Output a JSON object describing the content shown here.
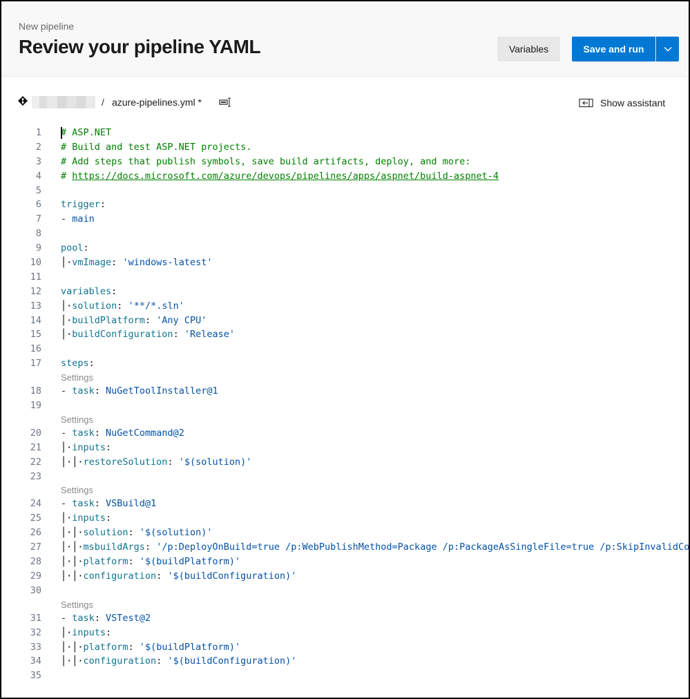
{
  "header": {
    "subtitle": "New pipeline",
    "title": "Review your pipeline YAML",
    "variables_button": "Variables",
    "save_run_button": "Save and run"
  },
  "filebar": {
    "separator": "/",
    "filename": "azure-pipelines.yml *",
    "show_assistant": "Show assistant"
  },
  "settings_label": "Settings",
  "lines": [
    {
      "n": "1",
      "segs": [
        [
          "comment",
          "# ASP.NET"
        ]
      ]
    },
    {
      "n": "2",
      "segs": [
        [
          "comment",
          "# Build and test ASP.NET projects."
        ]
      ]
    },
    {
      "n": "3",
      "segs": [
        [
          "comment",
          "# Add steps that publish symbols, save build artifacts, deploy, and more:"
        ]
      ]
    },
    {
      "n": "4",
      "segs": [
        [
          "comment",
          "# "
        ],
        [
          "link",
          "https://docs.microsoft.com/azure/devops/pipelines/apps/aspnet/build-aspnet-4"
        ]
      ]
    },
    {
      "n": "5",
      "segs": []
    },
    {
      "n": "6",
      "segs": [
        [
          "key",
          "trigger"
        ],
        [
          "plain",
          ":"
        ]
      ]
    },
    {
      "n": "7",
      "segs": [
        [
          "dash",
          "- "
        ],
        [
          "str",
          "main"
        ]
      ]
    },
    {
      "n": "8",
      "segs": []
    },
    {
      "n": "9",
      "segs": [
        [
          "key",
          "pool"
        ],
        [
          "plain",
          ":"
        ]
      ]
    },
    {
      "n": "10",
      "segs": [
        [
          "guide",
          "  "
        ],
        [
          "key",
          "vmImage"
        ],
        [
          "plain",
          ": "
        ],
        [
          "str",
          "'windows-latest'"
        ]
      ]
    },
    {
      "n": "11",
      "segs": []
    },
    {
      "n": "12",
      "segs": [
        [
          "key",
          "variables"
        ],
        [
          "plain",
          ":"
        ]
      ]
    },
    {
      "n": "13",
      "segs": [
        [
          "guide",
          "  "
        ],
        [
          "key",
          "solution"
        ],
        [
          "plain",
          ": "
        ],
        [
          "str",
          "'**/*.sln'"
        ]
      ]
    },
    {
      "n": "14",
      "segs": [
        [
          "guide",
          "  "
        ],
        [
          "key",
          "buildPlatform"
        ],
        [
          "plain",
          ": "
        ],
        [
          "str",
          "'Any CPU'"
        ]
      ]
    },
    {
      "n": "15",
      "segs": [
        [
          "guide",
          "  "
        ],
        [
          "key",
          "buildConfiguration"
        ],
        [
          "plain",
          ": "
        ],
        [
          "str",
          "'Release'"
        ]
      ]
    },
    {
      "n": "16",
      "segs": []
    },
    {
      "n": "17",
      "segs": [
        [
          "key",
          "steps"
        ],
        [
          "plain",
          ":"
        ]
      ]
    },
    {
      "settings": true
    },
    {
      "n": "18",
      "segs": [
        [
          "dash",
          "- "
        ],
        [
          "key",
          "task"
        ],
        [
          "plain",
          ": "
        ],
        [
          "str",
          "NuGetToolInstaller@1"
        ]
      ]
    },
    {
      "n": "19",
      "segs": []
    },
    {
      "settings": true
    },
    {
      "n": "20",
      "segs": [
        [
          "dash",
          "- "
        ],
        [
          "key",
          "task"
        ],
        [
          "plain",
          ": "
        ],
        [
          "str",
          "NuGetCommand@2"
        ]
      ]
    },
    {
      "n": "21",
      "segs": [
        [
          "guide",
          "  "
        ],
        [
          "key",
          "inputs"
        ],
        [
          "plain",
          ":"
        ]
      ]
    },
    {
      "n": "22",
      "segs": [
        [
          "guide",
          "    "
        ],
        [
          "key",
          "restoreSolution"
        ],
        [
          "plain",
          ": "
        ],
        [
          "str",
          "'$(solution)'"
        ]
      ]
    },
    {
      "n": "23",
      "segs": []
    },
    {
      "settings": true
    },
    {
      "n": "24",
      "segs": [
        [
          "dash",
          "- "
        ],
        [
          "key",
          "task"
        ],
        [
          "plain",
          ": "
        ],
        [
          "str",
          "VSBuild@1"
        ]
      ]
    },
    {
      "n": "25",
      "segs": [
        [
          "guide",
          "  "
        ],
        [
          "key",
          "inputs"
        ],
        [
          "plain",
          ":"
        ]
      ]
    },
    {
      "n": "26",
      "segs": [
        [
          "guide",
          "    "
        ],
        [
          "key",
          "solution"
        ],
        [
          "plain",
          ": "
        ],
        [
          "str",
          "'$(solution)'"
        ]
      ]
    },
    {
      "n": "27",
      "segs": [
        [
          "guide",
          "    "
        ],
        [
          "key",
          "msbuildArgs"
        ],
        [
          "plain",
          ": "
        ],
        [
          "str",
          "'/p:DeployOnBuild=true /p:WebPublishMethod=Package /p:PackageAsSingleFile=true /p:SkipInvalidConfigurations=true"
        ]
      ]
    },
    {
      "n": "28",
      "segs": [
        [
          "guide",
          "    "
        ],
        [
          "key",
          "platform"
        ],
        [
          "plain",
          ": "
        ],
        [
          "str",
          "'$(buildPlatform)'"
        ]
      ]
    },
    {
      "n": "29",
      "segs": [
        [
          "guide",
          "    "
        ],
        [
          "key",
          "configuration"
        ],
        [
          "plain",
          ": "
        ],
        [
          "str",
          "'$(buildConfiguration)'"
        ]
      ]
    },
    {
      "n": "30",
      "segs": []
    },
    {
      "settings": true
    },
    {
      "n": "31",
      "segs": [
        [
          "dash",
          "- "
        ],
        [
          "key",
          "task"
        ],
        [
          "plain",
          ": "
        ],
        [
          "str",
          "VSTest@2"
        ]
      ]
    },
    {
      "n": "32",
      "segs": [
        [
          "guide",
          "  "
        ],
        [
          "key",
          "inputs"
        ],
        [
          "plain",
          ":"
        ]
      ]
    },
    {
      "n": "33",
      "segs": [
        [
          "guide",
          "    "
        ],
        [
          "key",
          "platform"
        ],
        [
          "plain",
          ": "
        ],
        [
          "str",
          "'$(buildPlatform)'"
        ]
      ]
    },
    {
      "n": "34",
      "segs": [
        [
          "guide",
          "    "
        ],
        [
          "key",
          "configuration"
        ],
        [
          "plain",
          ": "
        ],
        [
          "str",
          "'$(buildConfiguration)'"
        ]
      ]
    },
    {
      "n": "35",
      "segs": []
    }
  ],
  "colors": {
    "accent": "#0078d4",
    "comment": "#008000",
    "key": "#0e7490",
    "string": "#0451a5"
  }
}
